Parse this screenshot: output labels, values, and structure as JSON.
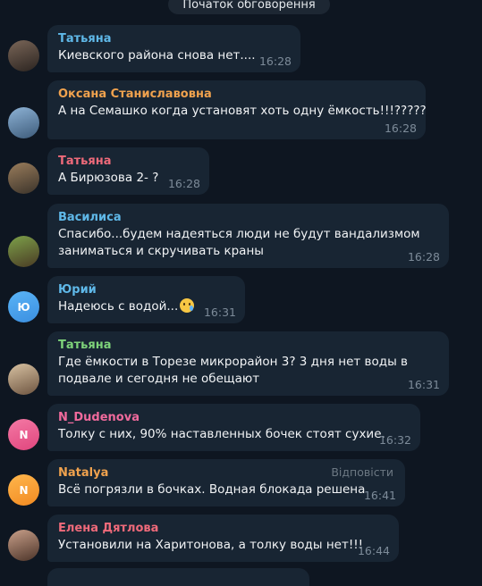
{
  "header": {
    "title": "Початок обговорення"
  },
  "messages": [
    {
      "author": "Татьяна",
      "author_color": "#5fb8e8",
      "lines": [
        "Киевского района снова нет...."
      ],
      "time": "16:28",
      "avatar": {
        "type": "photo",
        "colors": [
          "#7a6658",
          "#2b2420"
        ]
      }
    },
    {
      "author": "Оксана Станиславовна",
      "author_color": "#f0a24e",
      "lines": [
        "А на Семашко когда установят хоть одну ёмкость!!!?????"
      ],
      "time": "16:28",
      "avatar": {
        "type": "photo",
        "colors": [
          "#8eb3d6",
          "#3d5b7a"
        ]
      }
    },
    {
      "author": "Татьяна",
      "author_color": "#ef6a7a",
      "lines": [
        "А Бирюзова 2- ?"
      ],
      "time": "16:28",
      "avatar": {
        "type": "photo",
        "colors": [
          "#9a7d5c",
          "#3b332a"
        ]
      }
    },
    {
      "author": "Василиса",
      "author_color": "#5fb8e8",
      "lines": [
        "Спасибо...будем надеяться люди не будут вандализмом",
        "заниматься и скручивать краны"
      ],
      "time": "16:28",
      "avatar": {
        "type": "photo",
        "colors": [
          "#7da14a",
          "#4a3b24"
        ]
      }
    },
    {
      "author": "Юрий",
      "author_color": "#5fb8e8",
      "lines": [
        "Надеюсь с водой..."
      ],
      "emoji": "crying-face",
      "time": "16:31",
      "avatar": {
        "type": "initials",
        "initials": "Ю",
        "colors": [
          "#5ab4f7",
          "#3b8fe0"
        ]
      }
    },
    {
      "author": "Татьяна",
      "author_color": "#7ed37a",
      "lines": [
        "Где ёмкости в Торезе микрорайон 3? 3 дня нет воды в",
        "подвале и сегодня не обещают"
      ],
      "time": "16:31",
      "avatar": {
        "type": "photo",
        "colors": [
          "#d8c2a2",
          "#6d5440"
        ]
      }
    },
    {
      "author": "N_Dudenova",
      "author_color": "#f06a9c",
      "lines": [
        "Толку с них, 90% наставленных бочек стоят сухие."
      ],
      "time": "16:32",
      "avatar": {
        "type": "initials",
        "initials": "N",
        "colors": [
          "#f47aa5",
          "#e0457d"
        ]
      }
    },
    {
      "author": "Natalya",
      "author_color": "#f0a24e",
      "lines": [
        "Всё погрязли в бочках. Водная блокада решена"
      ],
      "time": "16:41",
      "reply": "Відповісти",
      "avatar": {
        "type": "initials",
        "initials": "N",
        "colors": [
          "#ffb74d",
          "#f28a21"
        ]
      }
    },
    {
      "author": "Елена Дятлова",
      "author_color": "#ef6a7a",
      "lines": [
        "Установили на Харитонова, а толку воды нет!!!"
      ],
      "time": "16:44",
      "avatar": {
        "type": "photo",
        "colors": [
          "#c9a08a",
          "#4b3328"
        ]
      }
    }
  ]
}
